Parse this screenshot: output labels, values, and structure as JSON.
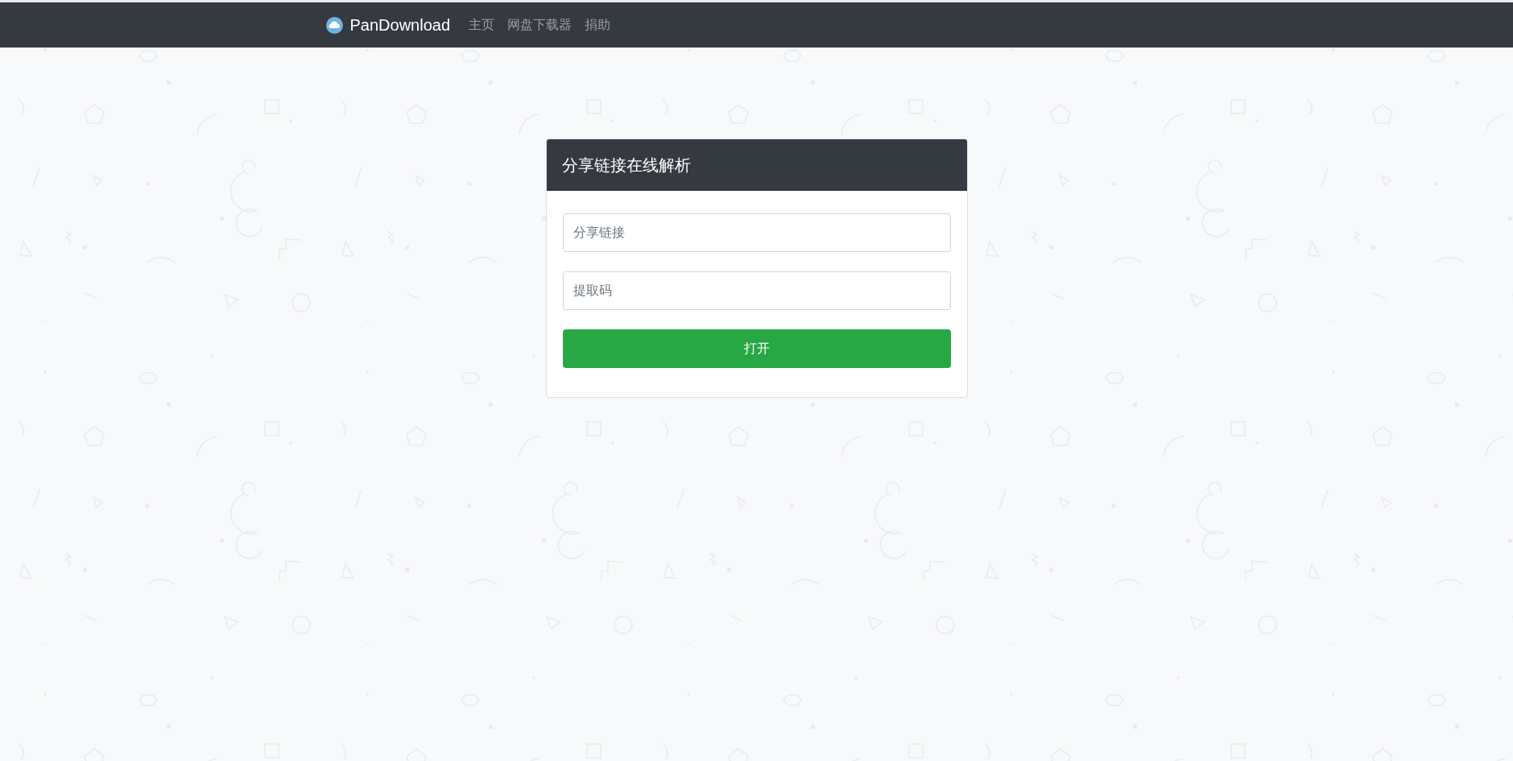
{
  "navbar": {
    "brand": "PanDownload",
    "links": [
      {
        "label": "主页"
      },
      {
        "label": "网盘下载器"
      },
      {
        "label": "捐助"
      }
    ]
  },
  "card": {
    "title": "分享链接在线解析",
    "fields": [
      {
        "placeholder": "分享链接"
      },
      {
        "placeholder": "提取码"
      }
    ],
    "button": "打开"
  }
}
